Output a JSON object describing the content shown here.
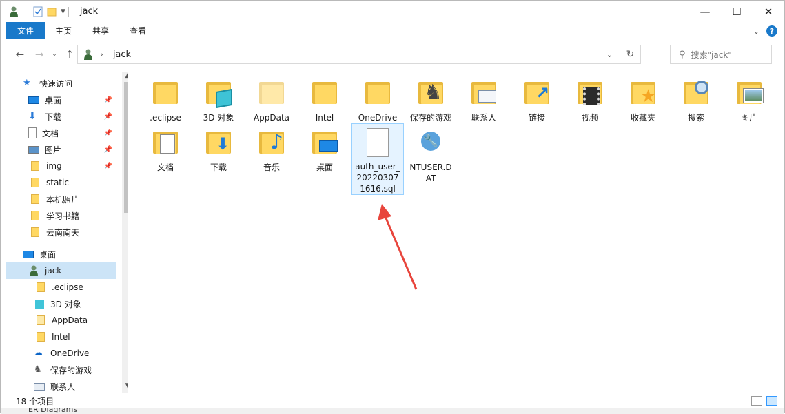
{
  "window": {
    "title": "jack",
    "controls": {
      "minimize": "—",
      "maximize": "☐",
      "close": "✕"
    }
  },
  "ribbon": {
    "tabs": [
      "文件",
      "主页",
      "共享",
      "查看"
    ]
  },
  "address": {
    "crumb": "jack",
    "search_placeholder": "搜索\"jack\""
  },
  "sidebar": {
    "items": [
      {
        "label": "快速访问",
        "icon": "star-icon",
        "pinned": false
      },
      {
        "label": "桌面",
        "icon": "desktop-icon",
        "pinned": true
      },
      {
        "label": "下载",
        "icon": "download-icon",
        "pinned": true
      },
      {
        "label": "文档",
        "icon": "document-icon",
        "pinned": true
      },
      {
        "label": "图片",
        "icon": "pictures-icon",
        "pinned": true
      },
      {
        "label": "img",
        "icon": "folder-icon",
        "pinned": true
      },
      {
        "label": "static",
        "icon": "folder-icon",
        "pinned": false
      },
      {
        "label": "本机照片",
        "icon": "folder-icon",
        "pinned": false
      },
      {
        "label": "学习书籍",
        "icon": "folder-icon",
        "pinned": false
      },
      {
        "label": "云南南天",
        "icon": "folder-icon",
        "pinned": false
      },
      {
        "label": "桌面",
        "icon": "desktop-icon",
        "pinned": false
      },
      {
        "label": "jack",
        "icon": "user-icon",
        "pinned": false
      },
      {
        "label": ".eclipse",
        "icon": "folder-icon",
        "pinned": false
      },
      {
        "label": "3D 对象",
        "icon": "3d-objects-icon",
        "pinned": false
      },
      {
        "label": "AppData",
        "icon": "folder-icon",
        "pinned": false
      },
      {
        "label": "Intel",
        "icon": "folder-icon",
        "pinned": false
      },
      {
        "label": "OneDrive",
        "icon": "onedrive-icon",
        "pinned": false
      },
      {
        "label": "保存的游戏",
        "icon": "saved-games-icon",
        "pinned": false
      },
      {
        "label": "联系人",
        "icon": "contacts-icon",
        "pinned": false
      }
    ]
  },
  "files": [
    {
      "label": ".eclipse",
      "icon": "folder-icon"
    },
    {
      "label": "3D 对象",
      "icon": "3d-objects-icon"
    },
    {
      "label": "AppData",
      "icon": "folder-icon"
    },
    {
      "label": "Intel",
      "icon": "folder-icon"
    },
    {
      "label": "OneDrive",
      "icon": "folder-icon"
    },
    {
      "label": "保存的游戏",
      "icon": "saved-games-icon"
    },
    {
      "label": "联系人",
      "icon": "contacts-icon"
    },
    {
      "label": "链接",
      "icon": "links-icon"
    },
    {
      "label": "视频",
      "icon": "videos-icon"
    },
    {
      "label": "收藏夹",
      "icon": "favorites-icon"
    },
    {
      "label": "搜索",
      "icon": "searches-icon"
    },
    {
      "label": "图片",
      "icon": "pictures-icon"
    },
    {
      "label": "文档",
      "icon": "documents-icon"
    },
    {
      "label": "下载",
      "icon": "downloads-icon"
    },
    {
      "label": "音乐",
      "icon": "music-icon"
    },
    {
      "label": "桌面",
      "icon": "desktop-icon"
    },
    {
      "label": "auth_user_202203071616.sql",
      "icon": "sql-file-icon"
    },
    {
      "label": "NTUSER.DAT",
      "icon": "dat-file-icon"
    }
  ],
  "status": {
    "count": "18 个项目"
  },
  "bottom_strip": "ER Diagrams",
  "colors": {
    "accent": "#1979ca",
    "folder": "#ffd863",
    "selection": "#cce4f7",
    "annotation_arrow": "#e8453c"
  }
}
